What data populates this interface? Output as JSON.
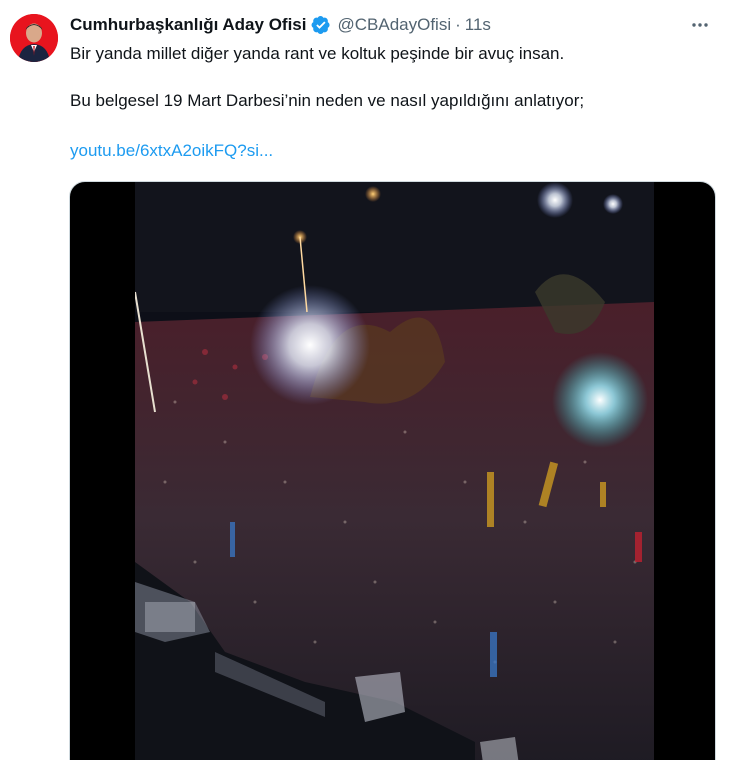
{
  "tweet": {
    "author_name": "Cumhurbaşkanlığı Aday Ofisi",
    "handle": "@CBAdayOfisi",
    "separator": "·",
    "timestamp": "11s",
    "verified_icon": "verified-badge-icon",
    "more_icon": "more-horizontal-icon",
    "text_line_1": "Bir yanda millet diğer yanda rant ve koltuk peşinde bir avuç insan.",
    "text_line_2": "Bu belgesel 19 Mart Darbesi’nin neden ve nasıl yapıldığını anlatıyor;",
    "link_text": "youtu.be/6xtxA2oikFQ?si...",
    "more_symbol": "···"
  },
  "colors": {
    "text_primary": "#0f1419",
    "text_secondary": "#536471",
    "link": "#1d9bf0",
    "verified": "#1d9bf0",
    "avatar_bg": "#e8141e"
  }
}
